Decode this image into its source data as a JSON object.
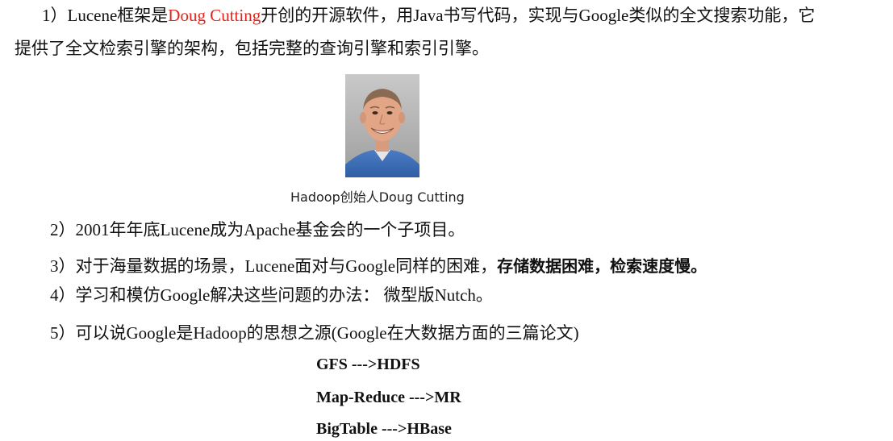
{
  "p1": {
    "num": "1）",
    "a": "Lucene框架是",
    "name": "Doug Cutting",
    "b": "开创的开源软件，用Java书写代码，实现与Google类似的全文搜索功能，它",
    "c": "提供了全文检索引擎的架构，包括完整的查询引擎和索引引擎。"
  },
  "photo_caption": "Hadoop创始人Doug Cutting",
  "p2": "2）2001年年底Lucene成为Apache基金会的一个子项目。",
  "p3": {
    "plain": "3）对于海量数据的场景，Lucene面对与Google同样的困难，",
    "bold": "存储数据困难，检索速度慢。"
  },
  "p4": "4）学习和模仿Google解决这些问题的办法： 微型版Nutch。",
  "p5": "5）可以说Google是Hadoop的思想之源(Google在大数据方面的三篇论文)",
  "mappings": [
    "GFS --->HDFS",
    "Map-Reduce --->MR",
    "BigTable --->HBase"
  ],
  "colors": {
    "highlight": "#e3231b",
    "text": "#111111"
  }
}
